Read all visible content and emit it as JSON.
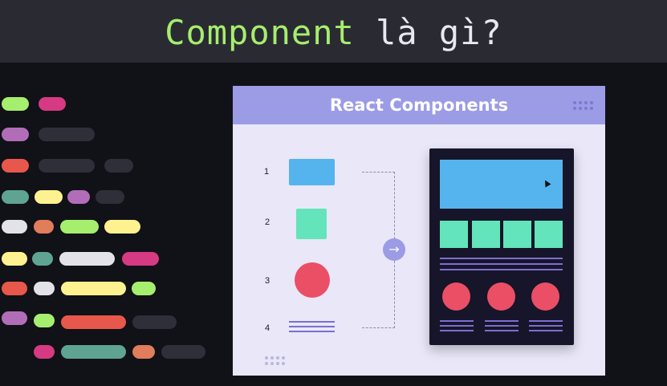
{
  "header": {
    "title_keyword": "Component",
    "title_rest": " là gì?"
  },
  "panel": {
    "title": "React Components",
    "items": [
      {
        "number": "1"
      },
      {
        "number": "2"
      },
      {
        "number": "3"
      },
      {
        "number": "4"
      }
    ]
  },
  "colors": {
    "green": "#a6ee6e",
    "pink": "#d63a82",
    "purple": "#b26db8",
    "gray": "#2f2f3a",
    "red": "#e8574b",
    "yellow": "#fdf28f",
    "teal": "#5fa493",
    "white": "#e2e2e8",
    "orange": "#e07d5a",
    "panel_header": "#9c9be6",
    "blue": "#55b4ee",
    "mint": "#63e4bb",
    "coral": "#ea4f66"
  },
  "icons": {
    "arrow": "arrow-right-icon",
    "cursor": "mouse-cursor-icon"
  }
}
